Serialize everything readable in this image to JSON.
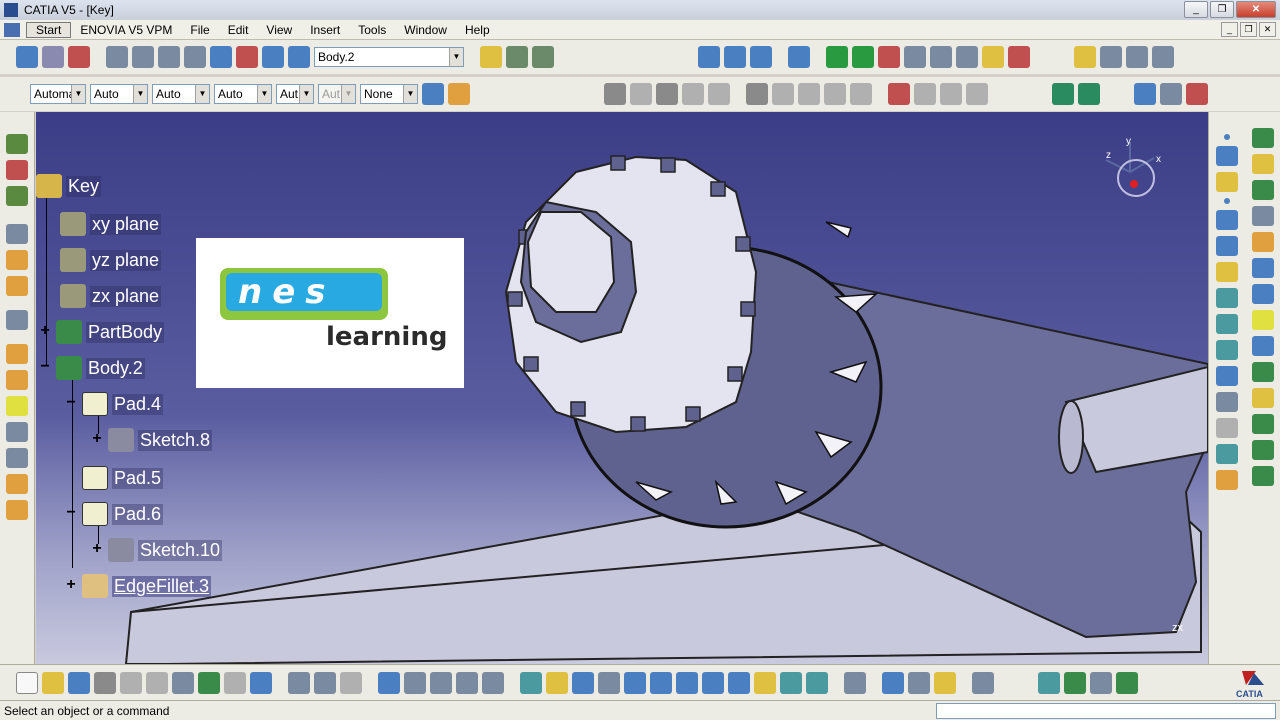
{
  "window": {
    "title": "CATIA V5 - [Key]"
  },
  "window_controls": {
    "minimize": "_",
    "restore": "❐",
    "close": "✕"
  },
  "menubar": {
    "items": [
      "Start",
      "ENOVIA V5 VPM",
      "File",
      "Edit",
      "View",
      "Insert",
      "Tools",
      "Window",
      "Help"
    ],
    "doc_controls": [
      "_",
      "❐",
      "✕"
    ]
  },
  "toolbar": {
    "body_select": "Body.2",
    "graphic_props": [
      "Automa",
      "Auto",
      "Auto",
      "Auto",
      "Aut",
      "Aut",
      "None"
    ]
  },
  "tree": {
    "nodes": [
      {
        "label": "Key",
        "icon": "product-icon"
      },
      {
        "label": "xy plane",
        "icon": "plane-icon"
      },
      {
        "label": "yz plane",
        "icon": "plane-icon"
      },
      {
        "label": "zx plane",
        "icon": "plane-icon"
      },
      {
        "label": "PartBody",
        "icon": "gear-icon",
        "expander": "+"
      },
      {
        "label": "Body.2",
        "icon": "gear-icon",
        "expander": "−"
      },
      {
        "label": "Pad.4",
        "icon": "pad-icon",
        "expander": "−"
      },
      {
        "label": "Sketch.8",
        "icon": "sketch-icon",
        "expander": "+"
      },
      {
        "label": "Pad.5",
        "icon": "pad-icon"
      },
      {
        "label": "Pad.6",
        "icon": "pad-icon",
        "expander": "−"
      },
      {
        "label": "Sketch.10",
        "icon": "sketch-icon",
        "expander": "+"
      },
      {
        "label": "EdgeFillet.3",
        "icon": "fillet-icon",
        "expander": "+",
        "selected": true
      }
    ]
  },
  "logo": {
    "brand": "nes",
    "tagline": "learning"
  },
  "compass": {
    "x": "x",
    "y": "y",
    "z": "z"
  },
  "status": {
    "text": "Select an object or a command"
  },
  "colors": {
    "viewport_top": "#3b3d86",
    "viewport_bottom": "#c9cadf",
    "logo_green": "#8dc63f",
    "logo_blue": "#29a9e1",
    "part_face": "#6a6c98",
    "part_light": "#e8e8f2"
  }
}
